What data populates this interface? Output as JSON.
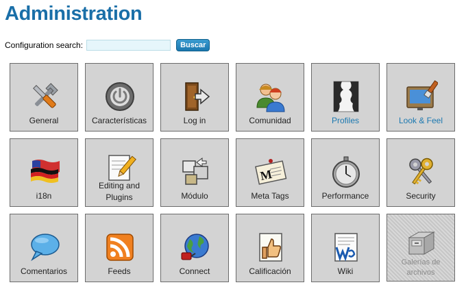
{
  "page": {
    "title": "Administration"
  },
  "search": {
    "label": "Configuration search:",
    "value": "",
    "button_label": "Buscar"
  },
  "tiles": [
    {
      "id": "general",
      "label": "General",
      "icon": "tools-icon"
    },
    {
      "id": "caracteristicas",
      "label": "Características",
      "icon": "power-icon"
    },
    {
      "id": "login",
      "label": "Log in",
      "icon": "door-icon"
    },
    {
      "id": "comunidad",
      "label": "Comunidad",
      "icon": "people-icon"
    },
    {
      "id": "profiles",
      "label": "Profiles",
      "icon": "profiles-icon"
    },
    {
      "id": "lookfeel",
      "label": "Look & Feel",
      "icon": "paint-icon"
    },
    {
      "id": "i18n",
      "label": "i18n",
      "icon": "flags-icon"
    },
    {
      "id": "editing",
      "label": "Editing and Plugins",
      "icon": "pencil-icon"
    },
    {
      "id": "modulo",
      "label": "Módulo",
      "icon": "modules-icon"
    },
    {
      "id": "metatags",
      "label": "Meta Tags",
      "icon": "tag-icon"
    },
    {
      "id": "performance",
      "label": "Performance",
      "icon": "stopwatch-icon"
    },
    {
      "id": "security",
      "label": "Security",
      "icon": "keys-icon"
    },
    {
      "id": "comentarios",
      "label": "Comentarios",
      "icon": "speech-bubble-icon"
    },
    {
      "id": "feeds",
      "label": "Feeds",
      "icon": "rss-icon"
    },
    {
      "id": "connect",
      "label": "Connect",
      "icon": "globe-plug-icon"
    },
    {
      "id": "calificacion",
      "label": "Calificación",
      "icon": "thumbs-up-icon"
    },
    {
      "id": "wiki",
      "label": "Wiki",
      "icon": "wiki-icon"
    },
    {
      "id": "galerias",
      "label": "Galerías de archivos",
      "icon": "file-cabinet-icon"
    }
  ]
}
